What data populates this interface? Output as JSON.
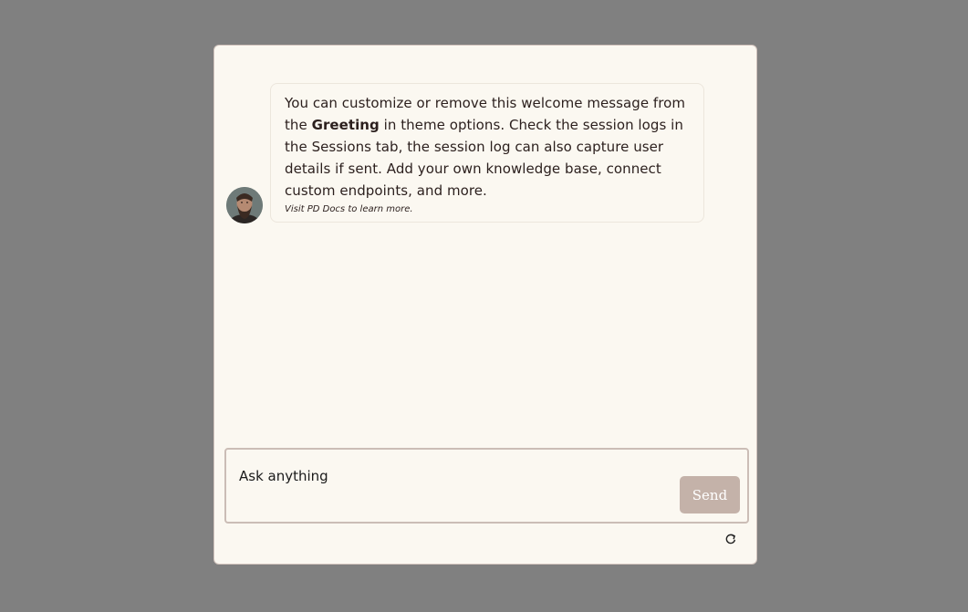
{
  "greeting": {
    "line_before_bold": "You can customize or remove this welcome message from the ",
    "bold": "Greeting",
    "line_after_bold": " in theme options. Check the session logs in the Sessions tab, the session log can also capture user details if sent. Add your own knowledge base, connect custom endpoints, and more.",
    "note": "Visit PD Docs to learn more."
  },
  "input": {
    "placeholder": "Ask anything",
    "value": ""
  },
  "send_label": "Send",
  "icons": {
    "avatar": "avatar",
    "refresh": "refresh-icon"
  },
  "colors": {
    "background": "#808080",
    "panel": "#fbf8f1",
    "send_button": "#c4b2a9",
    "text": "#2b1f1d"
  }
}
